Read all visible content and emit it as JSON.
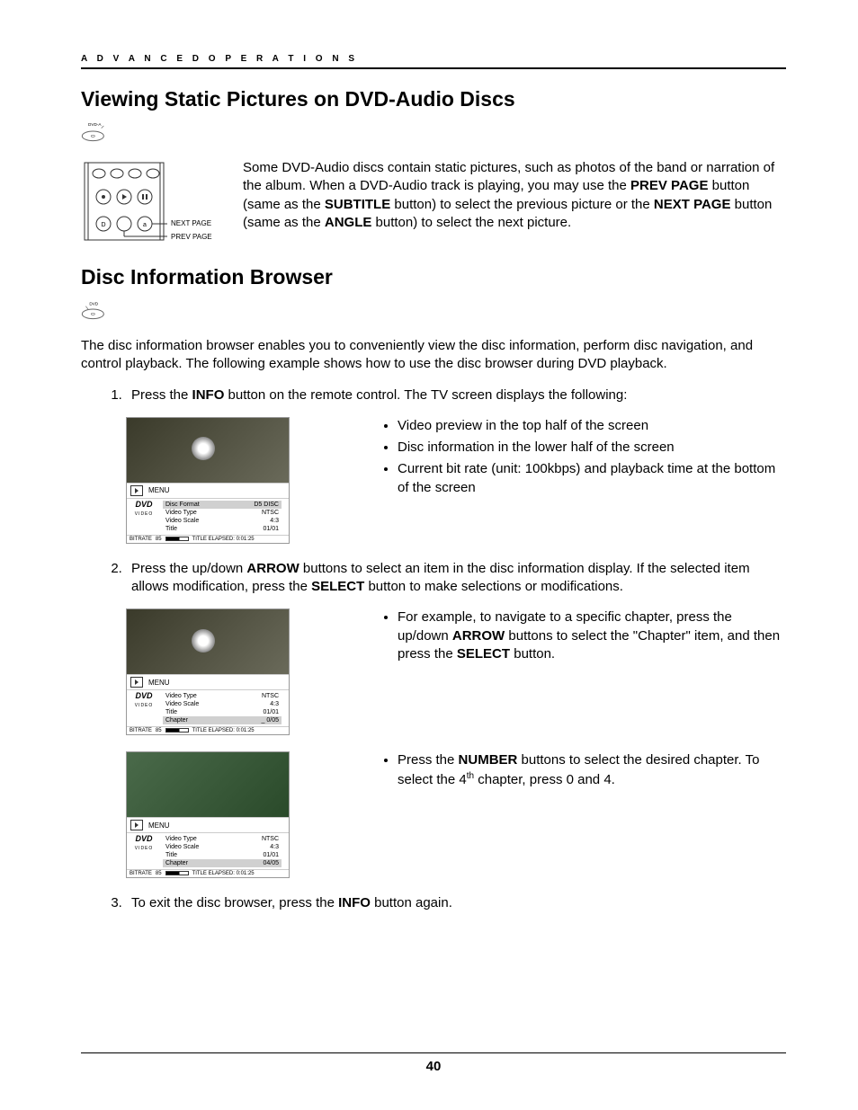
{
  "header": "A D V A N C E D   O P E R A T I O N S",
  "page_number": "40",
  "section1": {
    "title": "Viewing Static Pictures on DVD-Audio Discs",
    "disc_label": "DVD-A",
    "remote_labels": {
      "next": "NEXT PAGE",
      "prev": "PREV PAGE"
    },
    "paragraph_parts": [
      "Some DVD-Audio discs contain static pictures, such as photos of the band or narration of the album.  When a DVD-Audio track is playing, you may use the ",
      "PREV PAGE",
      " button (same as the ",
      "SUBTITLE",
      " button) to select the previous picture or the ",
      "NEXT PAGE",
      " button (same as the ",
      "ANGLE",
      " button) to select the next picture."
    ]
  },
  "section2": {
    "title": "Disc Information Browser",
    "disc_label": "DVD",
    "intro": "The disc information browser enables you to conveniently view the disc information, perform disc navigation, and control playback.  The following example shows how to use the disc browser during DVD playback.",
    "step1_parts": [
      "Press the ",
      "INFO",
      " button on the remote control.  The TV screen displays the following:"
    ],
    "step1_bullets": [
      "Video preview in the top half of the screen",
      "Disc information in the lower half of the screen",
      "Current bit rate (unit: 100kbps) and playback time at the bottom of the screen"
    ],
    "step2_parts": [
      "Press the up/down ",
      "ARROW",
      " buttons to select an item in the disc information display.  If the selected item allows modification, press the ",
      "SELECT",
      " button to make selections or modifications."
    ],
    "step2_bullet_parts": [
      "For example, to navigate to a specific chapter, press the up/down ",
      "ARROW",
      " buttons to select the \"Chapter\" item, and then press the ",
      "SELECT",
      " button."
    ],
    "step2b_bullet_parts": [
      "Press the ",
      "NUMBER",
      " buttons to select the desired chapter.  To select the 4",
      "th",
      " chapter, press 0 and 4."
    ],
    "step3_parts": [
      "To exit the disc browser, press the ",
      "INFO",
      " button again."
    ]
  },
  "screenshots": {
    "common": {
      "menu": "MENU",
      "logo": "DVD",
      "logo_sub": "VIDEO",
      "bitrate_label": "BITRATE",
      "bitrate_value": "85",
      "elapsed": "TITLE ELAPSED: 0:01:25"
    },
    "shot1": {
      "rows": [
        {
          "k": "Disc Format",
          "v": "D5 DISC",
          "sel": true
        },
        {
          "k": "Video Type",
          "v": "NTSC"
        },
        {
          "k": "Video Scale",
          "v": "4:3"
        },
        {
          "k": "Title",
          "v": "01/01"
        }
      ]
    },
    "shot2": {
      "rows": [
        {
          "k": "Video Type",
          "v": "NTSC"
        },
        {
          "k": "Video Scale",
          "v": "4:3"
        },
        {
          "k": "Title",
          "v": "01/01"
        },
        {
          "k": "Chapter",
          "v": "_ 0/05",
          "sel": true
        }
      ]
    },
    "shot3": {
      "rows": [
        {
          "k": "Video Type",
          "v": "NTSC"
        },
        {
          "k": "Video Scale",
          "v": "4:3"
        },
        {
          "k": "Title",
          "v": "01/01"
        },
        {
          "k": "Chapter",
          "v": "04/05",
          "sel": true
        }
      ]
    }
  }
}
